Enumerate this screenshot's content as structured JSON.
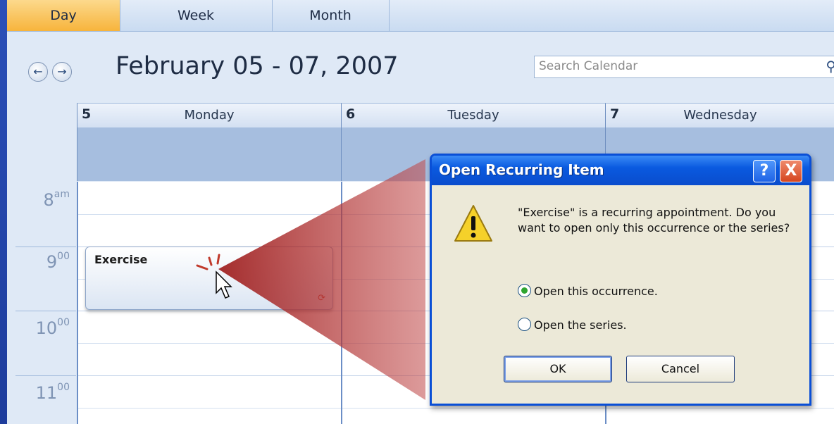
{
  "tabs": {
    "day": "Day",
    "week": "Week",
    "month": "Month"
  },
  "header": {
    "date_range": "February 05 - 07, 2007"
  },
  "search": {
    "placeholder": "Search Calendar"
  },
  "days": [
    {
      "num": "5",
      "name": "Monday"
    },
    {
      "num": "6",
      "name": "Tuesday"
    },
    {
      "num": "7",
      "name": "Wednesday"
    }
  ],
  "times": [
    {
      "hour": "8",
      "suffix": "am"
    },
    {
      "hour": "9",
      "suffix": "00"
    },
    {
      "hour": "10",
      "suffix": "00"
    },
    {
      "hour": "11",
      "suffix": "00"
    }
  ],
  "appointment": {
    "title": "Exercise"
  },
  "dialog": {
    "title": "Open Recurring Item",
    "help": "?",
    "close": "X",
    "message": "\"Exercise\" is a recurring appointment. Do you want to open only this occurrence or the series?",
    "option_occurrence": "Open this occurrence.",
    "option_series": "Open the series.",
    "ok": "OK",
    "cancel": "Cancel"
  },
  "colors": {
    "accent_tab": "#f7b43c",
    "dialog_title": "#0a4ccc",
    "callout": "#b03030"
  },
  "icons": [
    "back-arrow-icon",
    "forward-arrow-icon",
    "search-icon",
    "recurrence-icon",
    "warning-icon",
    "mouse-pointer-icon"
  ]
}
